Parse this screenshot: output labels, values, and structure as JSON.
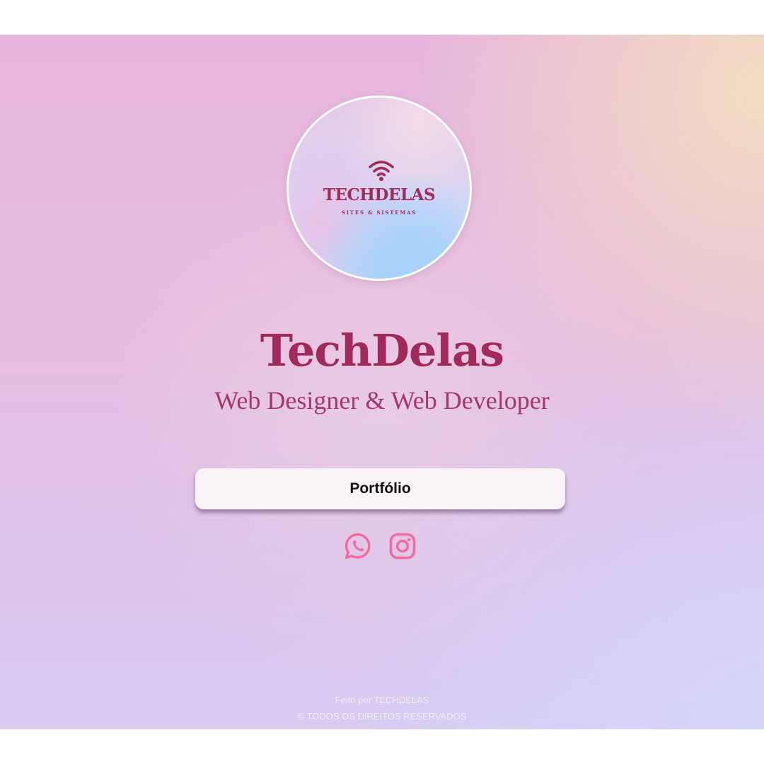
{
  "logo": {
    "brand_word": "TECHDELAS",
    "tagline": "SITES & SISTEMAS",
    "icon": "wifi-icon"
  },
  "header": {
    "title": "TechDelas",
    "subtitle": "Web Designer & Web Developer"
  },
  "links": {
    "portfolio_label": "Portfólio"
  },
  "social": [
    {
      "name": "whatsapp",
      "icon": "whatsapp-icon"
    },
    {
      "name": "instagram",
      "icon": "instagram-icon"
    }
  ],
  "footer": {
    "made_by": "Feito por TECHDELAS",
    "copyright": "© TODOS OS DIREITOS RESERVADOS"
  },
  "colors": {
    "brand": "#a12a5b",
    "social_icon": "#f46aa0",
    "button_bg": "#faf3f8",
    "footer_text": "#f4edf7"
  }
}
